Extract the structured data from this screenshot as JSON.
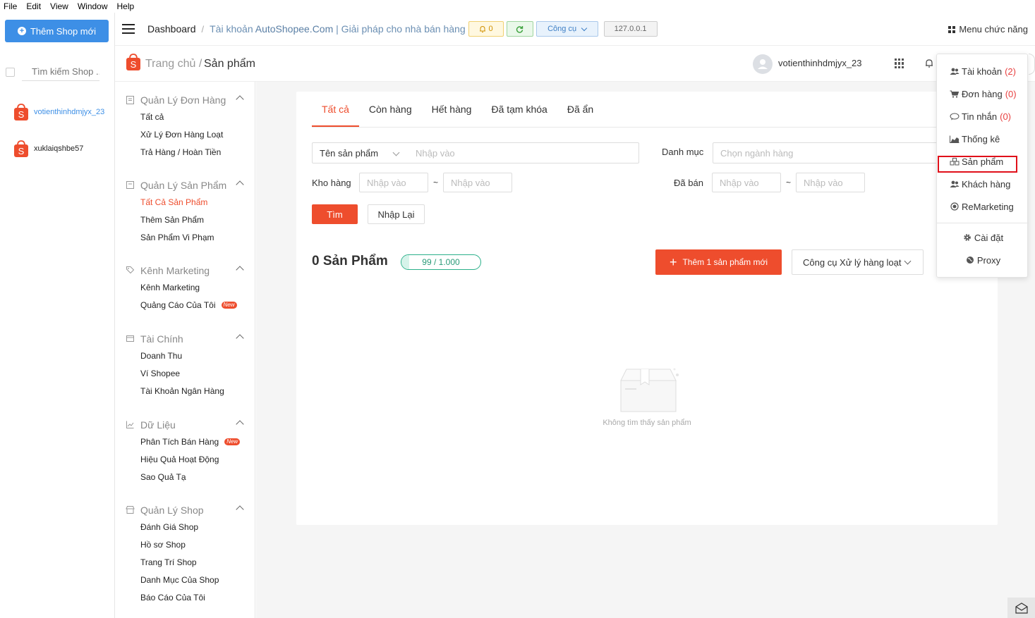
{
  "menubar": [
    "File",
    "Edit",
    "View",
    "Window",
    "Help"
  ],
  "shop_panel": {
    "add_shop_label": "Thêm Shop mới",
    "search_placeholder": "Tìm kiếm Shop ..",
    "shops": [
      "votienthinhdmjyx_23",
      "xuklaiqshbe57"
    ]
  },
  "header": {
    "dashboard": "Dashboard",
    "separator": "/",
    "account_prefix": "Tài khoản ",
    "account_brand": "AutoShopee.Com",
    "account_suffix": " | Giải pháp cho nhà bán hàng",
    "bell_count": "0",
    "tools_label": "Công cụ",
    "ip": "127.0.0.1",
    "menu_functions": "Menu chức năng"
  },
  "subheader": {
    "home": "Trang chủ /",
    "current": "Sản phẩm",
    "username": "votienthinhdmjyx_23"
  },
  "nav": {
    "sections": [
      {
        "title": "Quản Lý Đơn Hàng",
        "items": [
          "Tất cả",
          "Xử Lý Đơn Hàng Loạt",
          "Trả Hàng / Hoàn Tiền"
        ]
      },
      {
        "title": "Quản Lý Sản Phẩm",
        "items": [
          "Tất Cả Sản Phẩm",
          "Thêm Sản Phẩm",
          "Sản Phẩm Vi Phạm"
        ]
      },
      {
        "title": "Kênh Marketing",
        "items": [
          "Kênh Marketing",
          "Quảng Cáo Của Tôi"
        ]
      },
      {
        "title": "Tài Chính",
        "items": [
          "Doanh Thu",
          "Ví Shopee",
          "Tài Khoản Ngân Hàng"
        ]
      },
      {
        "title": "Dữ Liệu",
        "items": [
          "Phân Tích Bán Hàng",
          "Hiệu Quả Hoạt Động",
          "Sao Quả Tạ"
        ]
      },
      {
        "title": "Quản Lý Shop",
        "items": [
          "Đánh Giá Shop",
          "Hồ sơ Shop",
          "Trang Trí Shop",
          "Danh Mục Của Shop",
          "Báo Cáo Của Tôi"
        ]
      }
    ],
    "new_badge": "New"
  },
  "main": {
    "tabs": [
      "Tất cả",
      "Còn hàng",
      "Hết hàng",
      "Đã tạm khóa",
      "Đã ẩn"
    ],
    "filter": {
      "name_select": "Tên sản phẩm",
      "input_placeholder": "Nhập vào",
      "category_label": "Danh mục",
      "category_placeholder": "Chọn ngành hàng",
      "stock_label": "Kho hàng",
      "sold_label": "Đã bán",
      "range_sep": "~",
      "find_label": "Tìm",
      "reset_label": "Nhập Lại"
    },
    "product_count_label": "0 Sản Phẩm",
    "quota_text": "99 / 1.000",
    "quota_fraction": 0.099,
    "add_product_label": "Thêm 1 sản phẩm mới",
    "bulk_tools_label": "Công cụ Xử lý hàng loạt",
    "empty_text": "Không tìm thấy sản phẩm"
  },
  "fn_menu": {
    "items": [
      {
        "label": "Tài khoản",
        "count": "(2)",
        "icon": "users-icon"
      },
      {
        "label": "Đơn hàng",
        "count": "(0)",
        "icon": "cart-icon"
      },
      {
        "label": "Tin nhắn",
        "count": "(0)",
        "icon": "chat-icon"
      },
      {
        "label": "Thống kê",
        "count": "",
        "icon": "chart-icon"
      },
      {
        "label": "Sản phẩm",
        "count": "",
        "icon": "cubes-icon"
      },
      {
        "label": "Khách hàng",
        "count": "",
        "icon": "users-icon"
      },
      {
        "label": "ReMarketing",
        "count": "",
        "icon": "target-icon"
      }
    ],
    "settings": "Cài đặt",
    "proxy": "Proxy"
  },
  "colors": {
    "shopee_orange": "#ee4d2d",
    "primary_blue": "#3d8fe6",
    "highlight_red": "#e0101a"
  }
}
